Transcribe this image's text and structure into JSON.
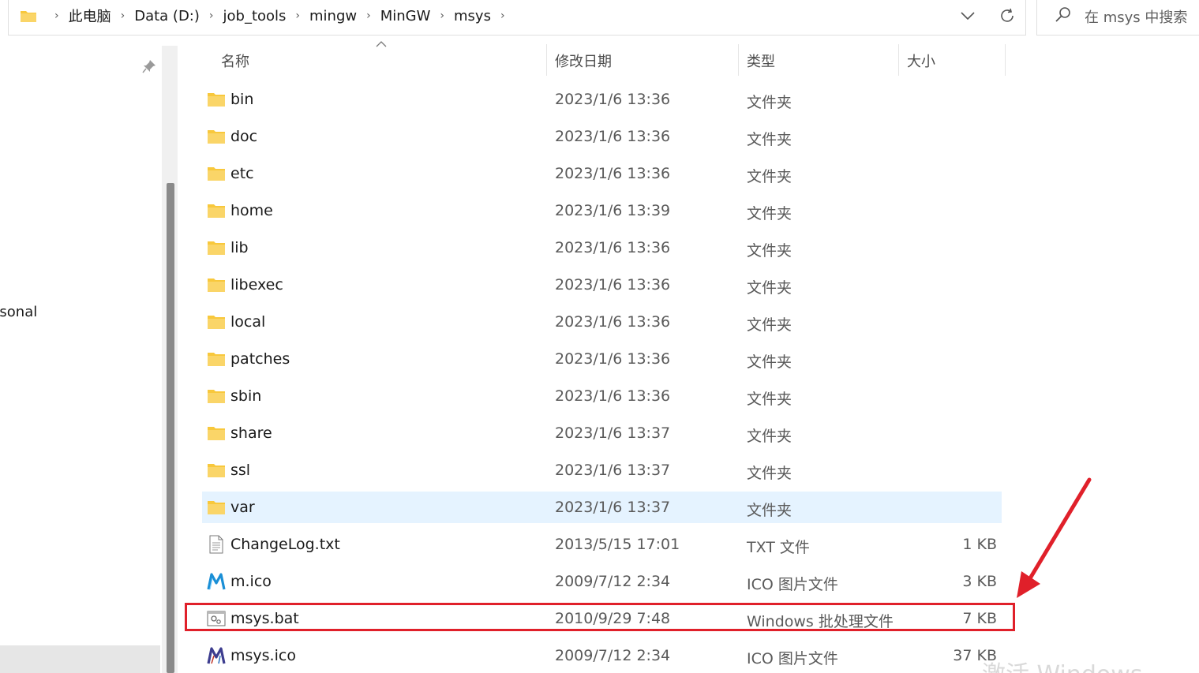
{
  "address_bar": {
    "breadcrumbs": [
      "此电脑",
      "Data (D:)",
      "job_tools",
      "mingw",
      "MinGW",
      "msys"
    ]
  },
  "search": {
    "placeholder": "在 msys 中搜索"
  },
  "nav_pane": {
    "visible_text": "rsonal"
  },
  "columns": {
    "name": "名称",
    "modified": "修改日期",
    "type": "类型",
    "size": "大小"
  },
  "files": [
    {
      "name": "bin",
      "modified": "2023/1/6 13:36",
      "type": "文件夹",
      "size": "",
      "icon": "folder-icon"
    },
    {
      "name": "doc",
      "modified": "2023/1/6 13:36",
      "type": "文件夹",
      "size": "",
      "icon": "folder-icon"
    },
    {
      "name": "etc",
      "modified": "2023/1/6 13:36",
      "type": "文件夹",
      "size": "",
      "icon": "folder-icon"
    },
    {
      "name": "home",
      "modified": "2023/1/6 13:39",
      "type": "文件夹",
      "size": "",
      "icon": "folder-icon"
    },
    {
      "name": "lib",
      "modified": "2023/1/6 13:36",
      "type": "文件夹",
      "size": "",
      "icon": "folder-icon"
    },
    {
      "name": "libexec",
      "modified": "2023/1/6 13:36",
      "type": "文件夹",
      "size": "",
      "icon": "folder-icon"
    },
    {
      "name": "local",
      "modified": "2023/1/6 13:36",
      "type": "文件夹",
      "size": "",
      "icon": "folder-icon"
    },
    {
      "name": "patches",
      "modified": "2023/1/6 13:36",
      "type": "文件夹",
      "size": "",
      "icon": "folder-icon"
    },
    {
      "name": "sbin",
      "modified": "2023/1/6 13:36",
      "type": "文件夹",
      "size": "",
      "icon": "folder-icon"
    },
    {
      "name": "share",
      "modified": "2023/1/6 13:37",
      "type": "文件夹",
      "size": "",
      "icon": "folder-icon"
    },
    {
      "name": "ssl",
      "modified": "2023/1/6 13:37",
      "type": "文件夹",
      "size": "",
      "icon": "folder-icon"
    },
    {
      "name": "var",
      "modified": "2023/1/6 13:37",
      "type": "文件夹",
      "size": "",
      "icon": "folder-icon",
      "selected": true
    },
    {
      "name": "ChangeLog.txt",
      "modified": "2013/5/15 17:01",
      "type": "TXT 文件",
      "size": "1 KB",
      "icon": "text-file-icon"
    },
    {
      "name": "m.ico",
      "modified": "2009/7/12 2:34",
      "type": "ICO 图片文件",
      "size": "3 KB",
      "icon": "mingw-m-icon"
    },
    {
      "name": "msys.bat",
      "modified": "2010/9/29 7:48",
      "type": "Windows 批处理文件",
      "size": "7 KB",
      "icon": "batch-file-icon",
      "highlighted": true
    },
    {
      "name": "msys.ico",
      "modified": "2009/7/12 2:34",
      "type": "ICO 图片文件",
      "size": "37 KB",
      "icon": "msys-m-icon"
    }
  ],
  "annotation": {
    "color": "#e0202a",
    "target": "msys.bat"
  },
  "watermark": "激活 Windows",
  "colors": {
    "selected_row": "#e5f3ff",
    "folder_yellow": "#f8c83c",
    "highlight_red": "#e0202a"
  }
}
